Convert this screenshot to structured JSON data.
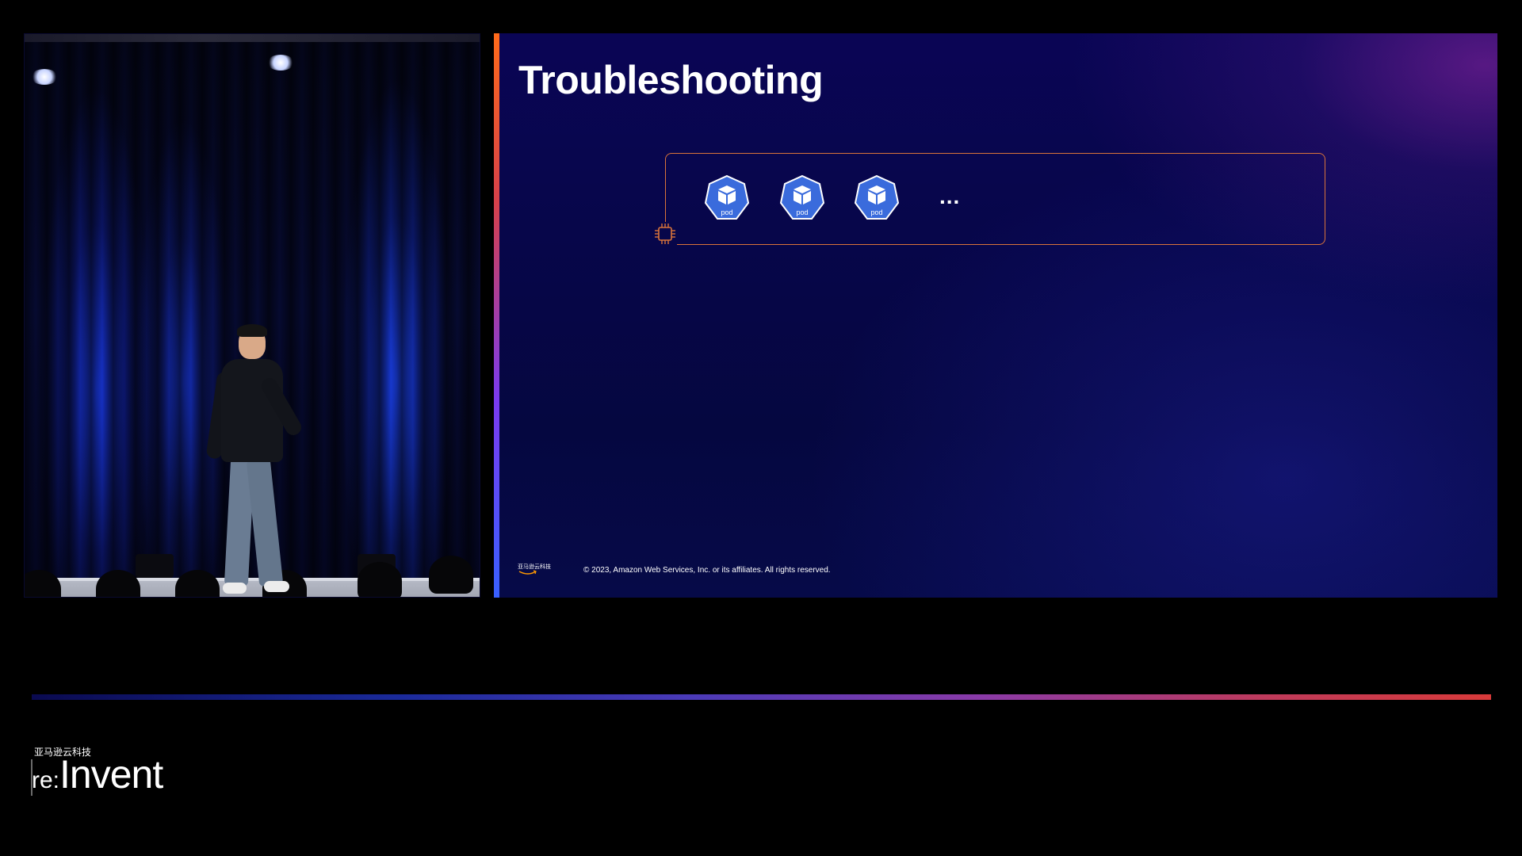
{
  "slide": {
    "title": "Troubleshooting",
    "pods": [
      {
        "label": "pod"
      },
      {
        "label": "pod"
      },
      {
        "label": "pod"
      }
    ],
    "ellipsis": "...",
    "logo_text": "亚马逊云科技",
    "copyright": "© 2023, Amazon Web Services, Inc. or its affiliates. All rights reserved."
  },
  "brand": {
    "cn_name": "亚马逊云科技",
    "logo_re": "re:",
    "logo_invent": "Invent"
  },
  "colors": {
    "accent_orange": "#d9743a",
    "pod_blue": "#3a6bdc",
    "slide_bg": "#07064a"
  },
  "icons": {
    "pod": "kubernetes-pod-icon",
    "node": "ec2-chip-icon"
  }
}
